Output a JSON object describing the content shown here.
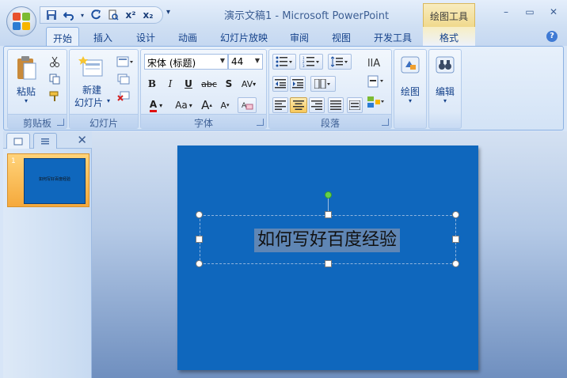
{
  "window": {
    "title": "演示文稿1 - Microsoft PowerPoint",
    "context_title": "绘图工具",
    "min": "–",
    "max": "▭",
    "close": "✕"
  },
  "qat": {
    "more": "▾"
  },
  "tabs": [
    {
      "label": "开始",
      "active": true
    },
    {
      "label": "插入"
    },
    {
      "label": "设计"
    },
    {
      "label": "动画"
    },
    {
      "label": "幻灯片放映"
    },
    {
      "label": "审阅"
    },
    {
      "label": "视图"
    },
    {
      "label": "开发工具"
    },
    {
      "label": "格式"
    }
  ],
  "help": "?",
  "ribbon": {
    "clipboard": {
      "label": "剪贴板",
      "paste": "粘贴",
      "paste_arrow": "▾"
    },
    "slides": {
      "label": "幻灯片",
      "new_line1": "新建",
      "new_line2": "幻灯片",
      "new_arrow": "▾"
    },
    "font": {
      "label": "字体",
      "font_name": "宋体 (标题)",
      "font_size": "44",
      "bold": "B",
      "italic": "I",
      "underline": "U",
      "strike": "abc",
      "shadow": "S",
      "spacing": "AV",
      "color": "A",
      "case": "Aa",
      "grow": "A",
      "shrink": "A"
    },
    "paragraph": {
      "label": "段落"
    },
    "drawing": {
      "label": "绘图"
    },
    "editing": {
      "label": "编辑"
    }
  },
  "pane": {
    "slide_number": "1",
    "close": "✕"
  },
  "slide": {
    "title": "如何写好百度经验",
    "background": "#0f67bd"
  },
  "colors": {
    "accent_orange": "#f5a93c",
    "font_color_underline": "#e01010"
  }
}
